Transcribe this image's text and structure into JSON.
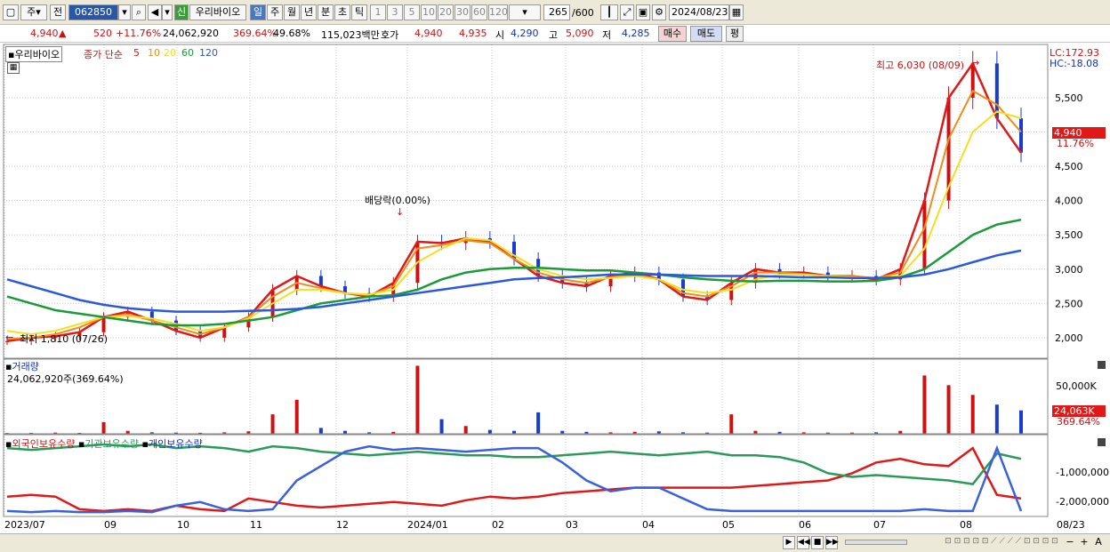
{
  "toolbar": {
    "type_label": "주",
    "prev_label": "전",
    "code_value": "062850",
    "new_badge": "신",
    "stock_name": "우리바이오",
    "periods": [
      "일",
      "주",
      "월",
      "년",
      "분",
      "초",
      "틱"
    ],
    "intervals": [
      "1",
      "3",
      "5",
      "10",
      "20",
      "30",
      "60",
      "120"
    ],
    "count_value": "265",
    "count_max": "/600",
    "date_value": "2024/08/23"
  },
  "info": {
    "price": "4,940",
    "change": "520",
    "change_pct": "+11.76%",
    "volume": "24,062,920",
    "vol_ratio": "369.64%",
    "turnover": "49.68%",
    "amount": "115,023백만",
    "quote_label": "호가",
    "ask": "4,940",
    "bid": "4,935",
    "open_label": "시",
    "open": "4,290",
    "high_label": "고",
    "high": "5,090",
    "low_label": "저",
    "low": "4,285",
    "buy_label": "매수",
    "sell_label": "매도",
    "eval_label": "평"
  },
  "price_panel": {
    "title": "우리바이오",
    "ma_label": "종가 단순",
    "ma_periods": [
      "5",
      "10",
      "20",
      "60",
      "120"
    ],
    "lc": "LC:172.93",
    "hc": "HC:-18.08",
    "high_note": "최고 6,030 (08/09)",
    "low_note": "최저 1,810 (07/26)",
    "div_note": "배당락(0.00%)",
    "last_price": "4,940",
    "last_pct": "11.76%"
  },
  "volume_panel": {
    "title": "거래량",
    "subtitle": "24,062,920주(369.64%)",
    "axis_tick": "50,000K",
    "last_value": "24,063K",
    "last_pct": "369.64%"
  },
  "holdings_panel": {
    "legend": [
      "외국인보유수량",
      "기관보유수량",
      "개인보유수량"
    ],
    "axis_ticks": [
      "-1,000,000",
      "-2,000,000"
    ]
  },
  "x_axis": {
    "labels": [
      "2023/07",
      "09",
      "10",
      "11",
      "12",
      "2024/01",
      "02",
      "03",
      "04",
      "05",
      "06",
      "07",
      "08"
    ],
    "end_label": "08/23"
  },
  "colors": {
    "up": "#d01010",
    "down": "#1a3bd0",
    "ma5": "#e01818",
    "ma10": "#f08c1a",
    "ma20": "#f0e020",
    "ma60": "#1a9a3a",
    "ma120": "#2a58e0",
    "foreign": "#e01818",
    "institution": "#2a9a5a",
    "individual": "#3a60e0"
  },
  "chart_data": [
    {
      "type": "line",
      "title": "우리바이오",
      "y_ticks": [
        2000,
        2500,
        3000,
        3500,
        4000,
        4500,
        5000,
        5500
      ],
      "ylim": [
        1700,
        6200
      ],
      "x_labels": [
        "2023/07",
        "09",
        "10",
        "11",
        "12",
        "2024/01",
        "02",
        "03",
        "04",
        "05",
        "06",
        "07",
        "08"
      ],
      "series": [
        {
          "name": "5",
          "values": [
            1950,
            2000,
            2020,
            2080,
            2300,
            2380,
            2250,
            2100,
            2000,
            2150,
            2300,
            2700,
            2900,
            2750,
            2650,
            2600,
            2800,
            3400,
            3380,
            3450,
            3400,
            3150,
            2900,
            2800,
            2750,
            2900,
            2950,
            2850,
            2600,
            2550,
            2800,
            3000,
            2950,
            2950,
            2900,
            2900,
            2850,
            3000,
            4000,
            5500,
            6000,
            5200,
            4700
          ]
        },
        {
          "name": "10",
          "values": [
            1980,
            2000,
            2050,
            2150,
            2300,
            2340,
            2250,
            2150,
            2050,
            2150,
            2300,
            2600,
            2800,
            2720,
            2650,
            2620,
            2750,
            3300,
            3350,
            3420,
            3380,
            3150,
            2950,
            2850,
            2800,
            2880,
            2920,
            2850,
            2650,
            2600,
            2750,
            2950,
            2950,
            2930,
            2900,
            2900,
            2870,
            2950,
            3600,
            4900,
            5600,
            5400,
            5000
          ]
        },
        {
          "name": "20",
          "values": [
            2100,
            2050,
            2100,
            2200,
            2300,
            2320,
            2280,
            2200,
            2100,
            2150,
            2280,
            2500,
            2700,
            2700,
            2650,
            2630,
            2700,
            3100,
            3300,
            3450,
            3420,
            3200,
            3000,
            2900,
            2850,
            2870,
            2900,
            2850,
            2700,
            2650,
            2700,
            2850,
            2920,
            2920,
            2900,
            2880,
            2870,
            2900,
            3300,
            4200,
            5000,
            5300,
            5200
          ]
        },
        {
          "name": "60",
          "values": [
            2600,
            2500,
            2400,
            2350,
            2300,
            2250,
            2200,
            2180,
            2180,
            2200,
            2250,
            2300,
            2400,
            2500,
            2550,
            2600,
            2620,
            2700,
            2850,
            2950,
            3000,
            3020,
            3020,
            3000,
            2980,
            2980,
            2950,
            2920,
            2880,
            2850,
            2830,
            2820,
            2830,
            2830,
            2820,
            2820,
            2830,
            2880,
            3000,
            3250,
            3500,
            3650,
            3720
          ]
        },
        {
          "name": "120",
          "values": [
            2850,
            2750,
            2650,
            2550,
            2480,
            2430,
            2400,
            2380,
            2380,
            2380,
            2390,
            2400,
            2420,
            2450,
            2500,
            2550,
            2600,
            2650,
            2700,
            2750,
            2800,
            2850,
            2870,
            2880,
            2900,
            2920,
            2920,
            2920,
            2910,
            2900,
            2900,
            2900,
            2890,
            2880,
            2880,
            2870,
            2870,
            2880,
            2920,
            3000,
            3100,
            3200,
            3270
          ]
        }
      ]
    },
    {
      "type": "bar",
      "title": "거래량",
      "ylim": [
        0,
        75000
      ],
      "values": [
        800,
        900,
        1200,
        900,
        12000,
        3000,
        1500,
        1200,
        1000,
        1500,
        2500,
        20000,
        35000,
        6000,
        3000,
        1500,
        2000,
        70000,
        15000,
        8000,
        4000,
        3000,
        22000,
        3000,
        2000,
        1500,
        2000,
        2500,
        1500,
        1200,
        20000,
        3000,
        2000,
        1500,
        1200,
        1200,
        1500,
        3000,
        60000,
        50000,
        40000,
        30000,
        24063
      ]
    },
    {
      "type": "line",
      "title": "보유수량",
      "ylim": [
        -2600000,
        -500000
      ],
      "series": [
        {
          "name": "외국인보유수량",
          "values": [
            -2050000,
            -2000000,
            -2050000,
            -2400000,
            -2450000,
            -2400000,
            -2450000,
            -2300000,
            -2400000,
            -2450000,
            -2100000,
            -2200000,
            -2300000,
            -2350000,
            -2300000,
            -2250000,
            -2200000,
            -2250000,
            -2300000,
            -2150000,
            -2050000,
            -2100000,
            -2050000,
            -1950000,
            -1900000,
            -1850000,
            -1800000,
            -1800000,
            -1800000,
            -1800000,
            -1800000,
            -1750000,
            -1700000,
            -1650000,
            -1600000,
            -1400000,
            -1100000,
            -1000000,
            -1150000,
            -1200000,
            -700000,
            -2000000,
            -2100000
          ]
        },
        {
          "name": "기관보유수량",
          "values": [
            -700000,
            -750000,
            -700000,
            -650000,
            -600000,
            -650000,
            -600000,
            -700000,
            -650000,
            -700000,
            -800000,
            -650000,
            -700000,
            -800000,
            -850000,
            -900000,
            -850000,
            -800000,
            -850000,
            -900000,
            -900000,
            -950000,
            -950000,
            -900000,
            -850000,
            -800000,
            -850000,
            -900000,
            -850000,
            -800000,
            -900000,
            -900000,
            -950000,
            -1100000,
            -1400000,
            -1500000,
            -1450000,
            -1500000,
            -1550000,
            -1600000,
            -1700000,
            -850000,
            -1000000
          ]
        },
        {
          "name": "개인보유수량",
          "values": [
            -2450000,
            -2480000,
            -2450000,
            -2480000,
            -2480000,
            -2450000,
            -2480000,
            -2300000,
            -2200000,
            -2400000,
            -2450000,
            -2400000,
            -1600000,
            -1200000,
            -800000,
            -650000,
            -750000,
            -700000,
            -750000,
            -800000,
            -750000,
            -700000,
            -700000,
            -1100000,
            -1600000,
            -1900000,
            -1800000,
            -1800000,
            -2100000,
            -2400000,
            -2450000,
            -2450000,
            -2450000,
            -2450000,
            -2450000,
            -2450000,
            -2450000,
            -2450000,
            -2400000,
            -2450000,
            -2450000,
            -700000,
            -2450000
          ]
        }
      ]
    }
  ]
}
